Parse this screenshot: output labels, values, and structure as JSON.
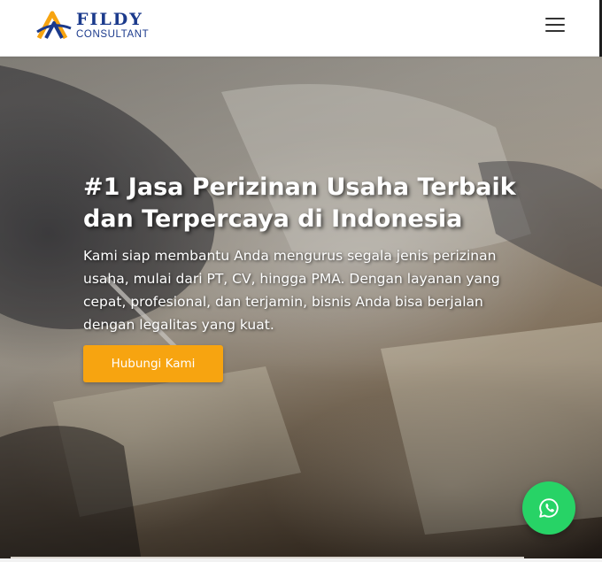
{
  "brand": {
    "name": "FILDY",
    "subtitle": "CONSULTANT",
    "logo_colors": {
      "blue": "#1b3a8c",
      "orange": "#f7a410"
    }
  },
  "nav": {
    "menu_icon": "hamburger-menu-icon"
  },
  "hero": {
    "title": "#1 Jasa Perizinan Usaha Terbaik dan Terpercaya di Indonesia",
    "description": "Kami siap membantu Anda mengurus segala jenis perizinan usaha, mulai dari PT, CV, hingga PMA. Dengan layanan yang cepat, profesional, dan terjamin, bisnis Anda bisa berjalan dengan legalitas yang kuat.",
    "cta_label": "Hubungi Kami",
    "cta_color": "#f7a410"
  },
  "floating": {
    "icon": "whatsapp-icon",
    "color": "#27d366"
  }
}
